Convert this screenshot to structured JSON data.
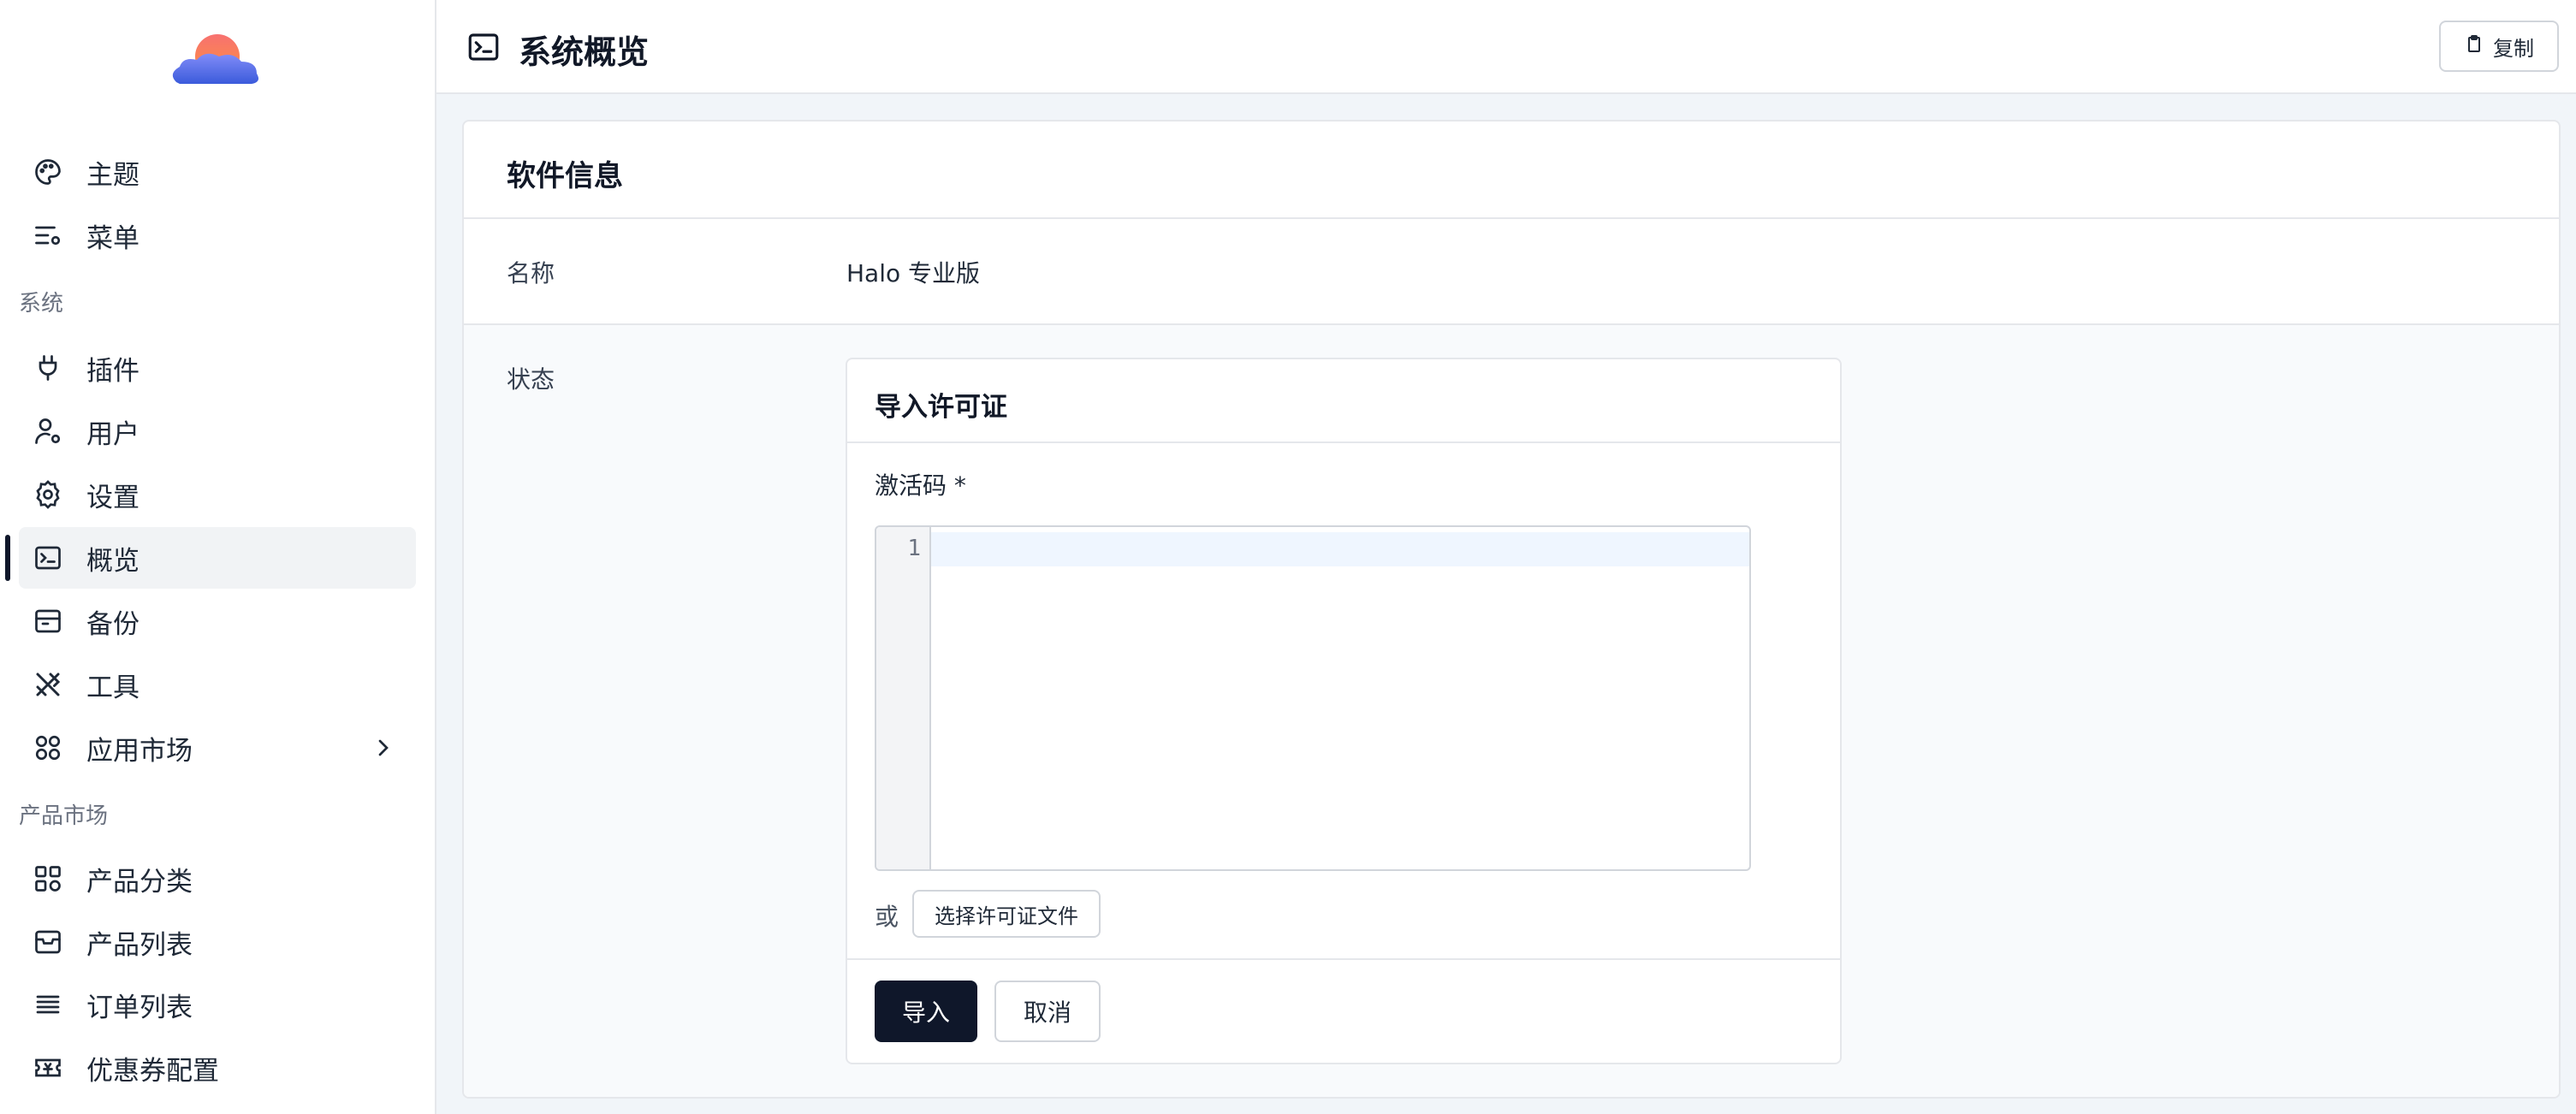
{
  "sidebar": {
    "items": [
      {
        "label": "主题",
        "icon": "palette-icon"
      },
      {
        "label": "菜单",
        "icon": "menu-settings-icon"
      },
      {
        "label": "插件",
        "icon": "plug-icon"
      },
      {
        "label": "用户",
        "icon": "user-settings-icon"
      },
      {
        "label": "设置",
        "icon": "gear-icon"
      },
      {
        "label": "概览",
        "icon": "terminal-icon"
      },
      {
        "label": "备份",
        "icon": "archive-icon"
      },
      {
        "label": "工具",
        "icon": "tools-icon"
      },
      {
        "label": "应用市场",
        "icon": "apps-icon"
      },
      {
        "label": "产品分类",
        "icon": "category-icon"
      },
      {
        "label": "产品列表",
        "icon": "inbox-icon"
      },
      {
        "label": "订单列表",
        "icon": "list-icon"
      },
      {
        "label": "优惠券配置",
        "icon": "coupon-icon"
      }
    ],
    "sections": {
      "system": "系统",
      "product_market": "产品市场"
    },
    "active_item": "概览"
  },
  "header": {
    "title": "系统概览",
    "copy_label": "复制"
  },
  "card": {
    "title": "软件信息",
    "rows": {
      "name": {
        "key": "名称",
        "value": "Halo 专业版"
      },
      "status": {
        "key": "状态"
      }
    }
  },
  "import_panel": {
    "title": "导入许可证",
    "field_label": "激活码 *",
    "line_number": "1",
    "or_text": "或",
    "select_file_label": "选择许可证文件",
    "import_label": "导入",
    "cancel_label": "取消"
  },
  "colors": {
    "accent": "#0f172a",
    "active_bg": "#f1f3f5",
    "page_bg": "#f1f5f9"
  }
}
